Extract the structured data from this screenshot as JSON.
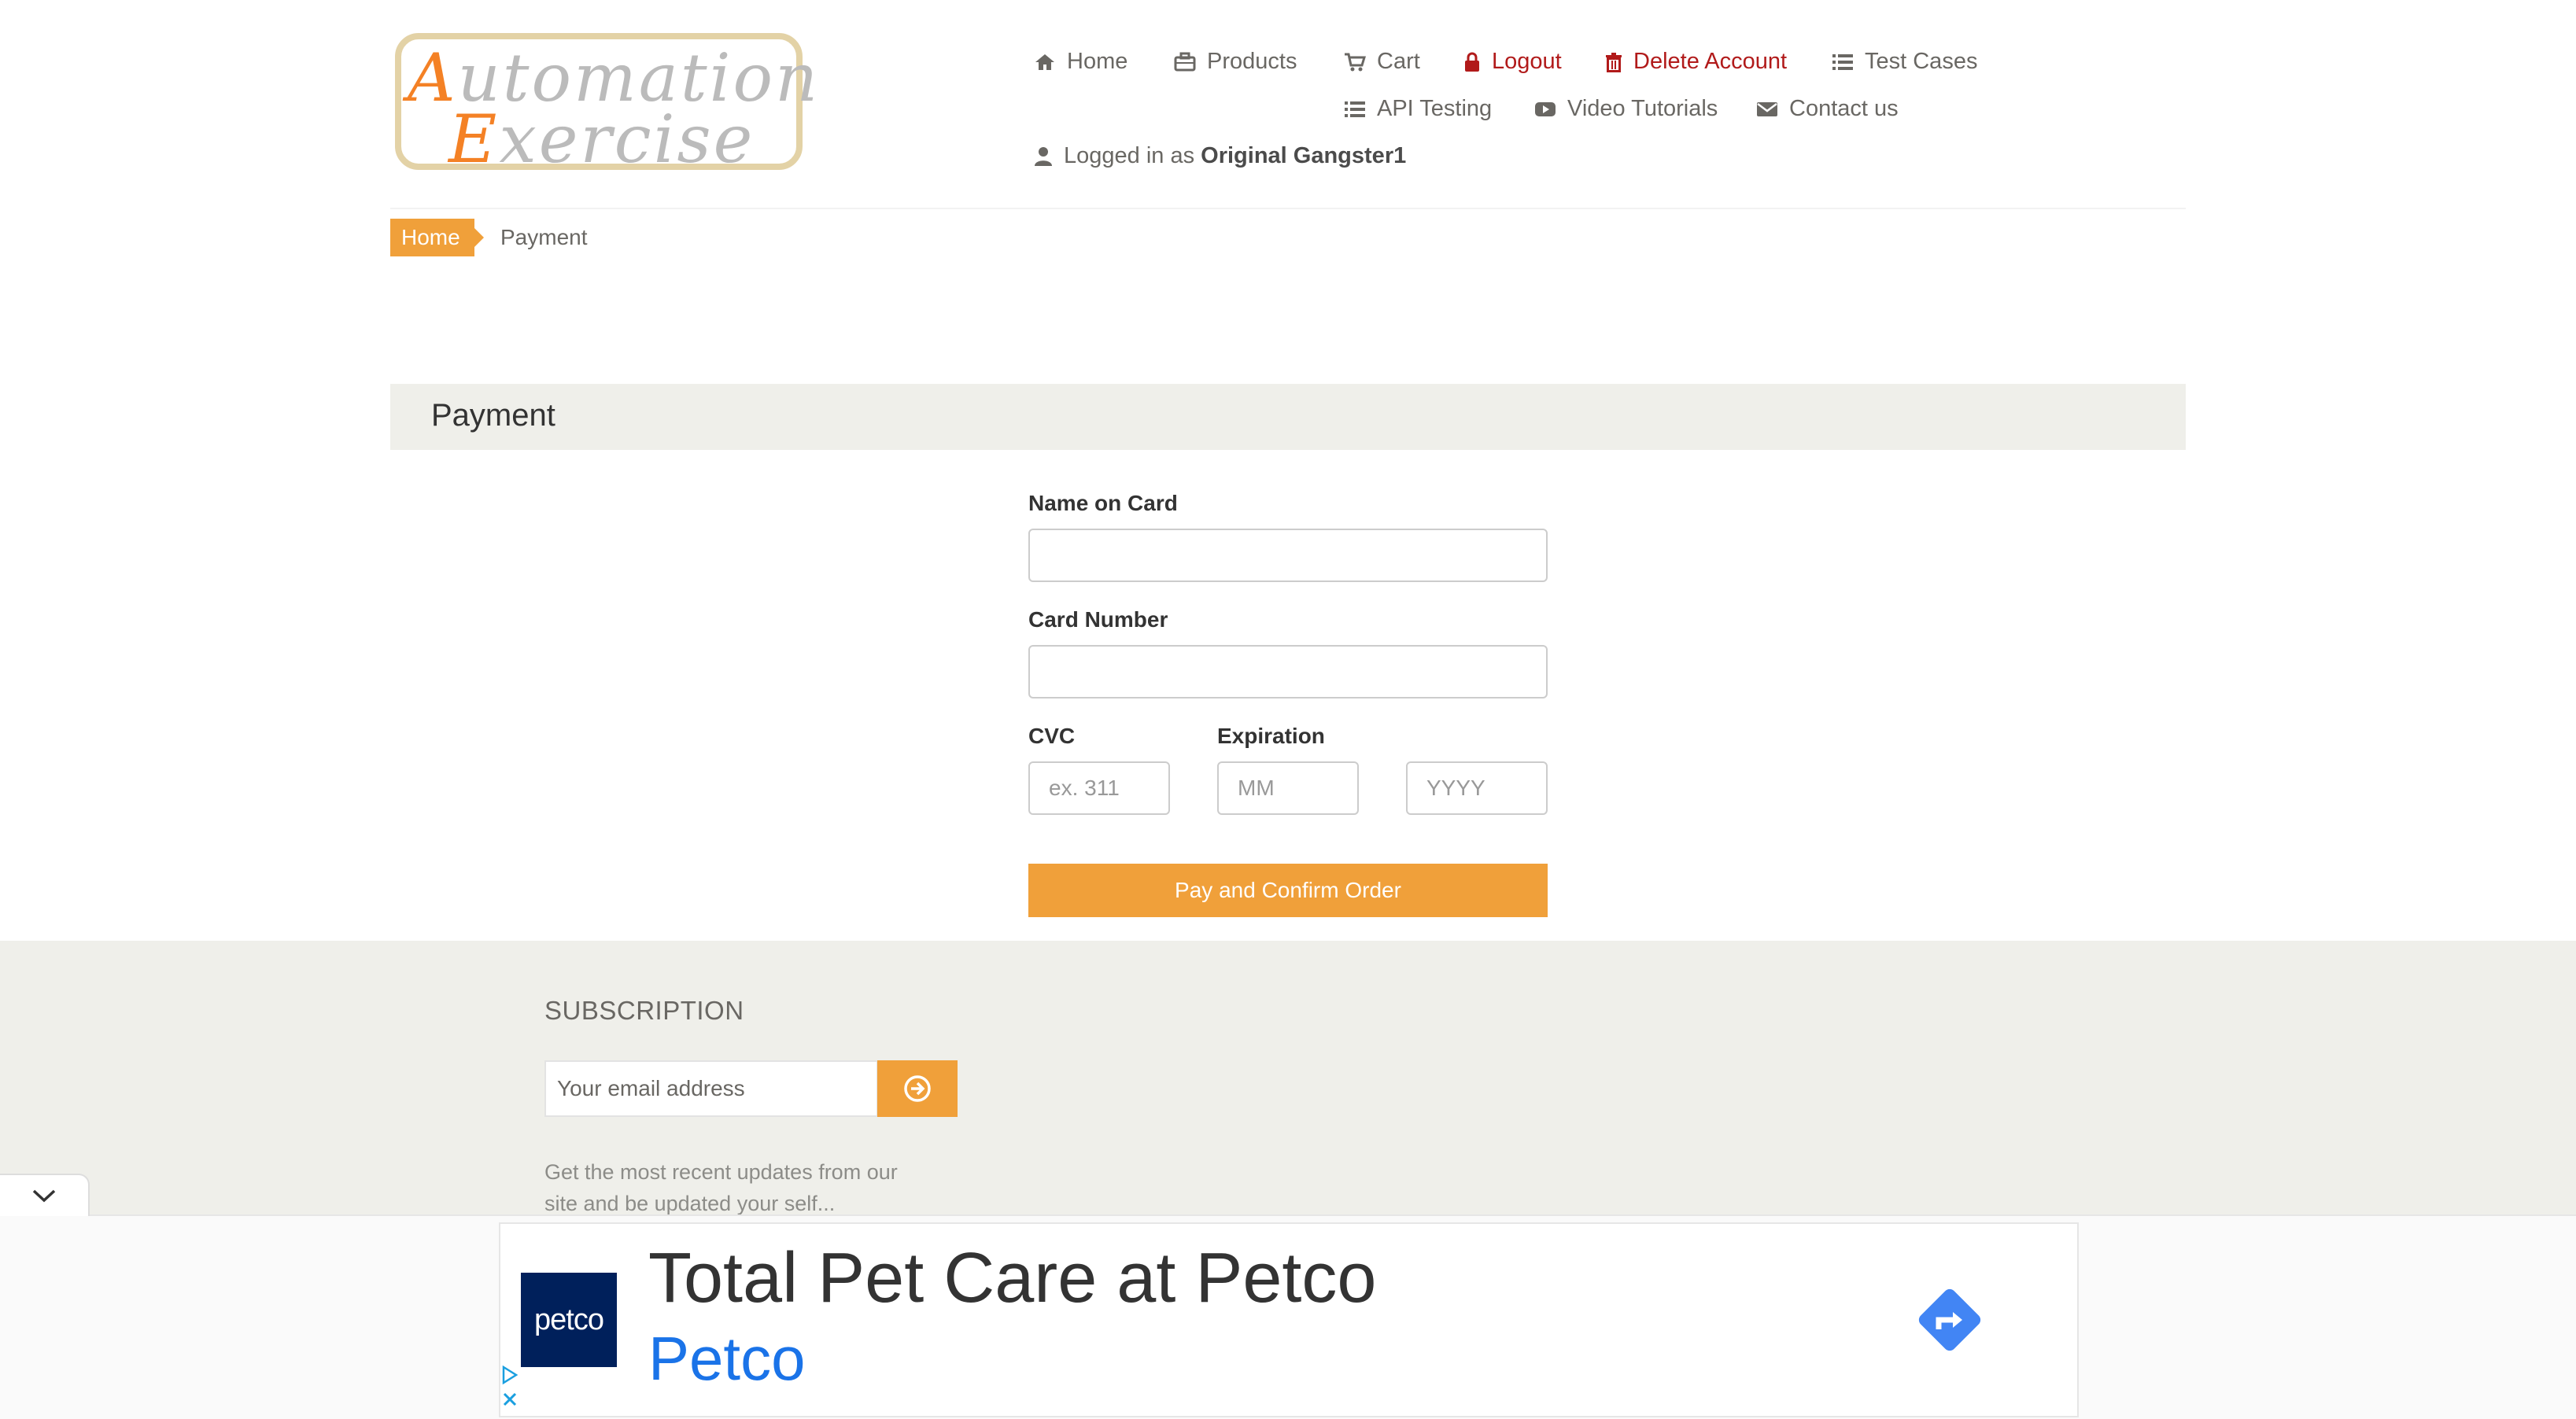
{
  "logo": {
    "line1_cap": "A",
    "line1_rest": "utomation",
    "line2_cap": "E",
    "line2_rest": "xercise"
  },
  "nav": {
    "home": "Home",
    "products": "Products",
    "cart": "Cart",
    "logout": "Logout",
    "delete_account": "Delete Account",
    "test_cases": "Test Cases",
    "api_testing": "API Testing",
    "video_tutorials": "Video Tutorials",
    "contact_us": "Contact us",
    "logged_in_prefix": "Logged in as",
    "username": "Original Gangster1"
  },
  "breadcrumb": {
    "home": "Home",
    "current": "Payment"
  },
  "payment": {
    "title": "Payment",
    "name_label": "Name on Card",
    "name_value": "",
    "card_label": "Card Number",
    "card_value": "",
    "cvc_label": "CVC",
    "cvc_placeholder": "ex. 311",
    "expiration_label": "Expiration",
    "month_placeholder": "MM",
    "year_placeholder": "YYYY",
    "submit_label": "Pay and Confirm Order"
  },
  "footer": {
    "subscription_title": "SUBSCRIPTION",
    "email_placeholder": "Your email address",
    "subscription_text": "Get the most recent updates from our site and be updated your self..."
  },
  "ad": {
    "logo_text": "petco",
    "headline": "Total Pet Care at Petco",
    "brand": "Petco"
  },
  "colors": {
    "accent": "#f0a03a",
    "danger": "#b11a1a",
    "panel": "#efefea",
    "text": "#696763"
  }
}
